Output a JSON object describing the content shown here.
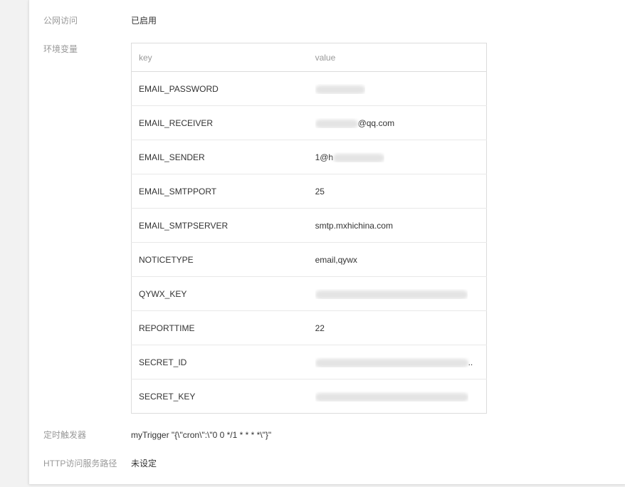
{
  "fields": {
    "public_access": {
      "label": "公网访问",
      "value": "已启用"
    },
    "env_vars": {
      "label": "环境变量"
    },
    "timer_trigger": {
      "label": "定时触发器",
      "value": "myTrigger \"{\\\"cron\\\":\\\"0 0 */1 * * * *\\\"}\""
    },
    "http_path": {
      "label": "HTTP访问服务路径",
      "value": "未设定"
    }
  },
  "env_table": {
    "headers": {
      "key": "key",
      "value": "value"
    },
    "rows": [
      {
        "key": "EMAIL_PASSWORD",
        "value_prefix": "",
        "value_suffix": "",
        "masked": true
      },
      {
        "key": "EMAIL_RECEIVER",
        "value_prefix": "",
        "value_suffix": "@qq.com",
        "masked": true
      },
      {
        "key": "EMAIL_SENDER",
        "value_prefix": "1@h",
        "value_suffix": "",
        "masked": true
      },
      {
        "key": "EMAIL_SMTPPORT",
        "value_prefix": "25",
        "value_suffix": "",
        "masked": false
      },
      {
        "key": "EMAIL_SMTPSERVER",
        "value_prefix": "smtp.mxhichina.com",
        "value_suffix": "",
        "masked": false
      },
      {
        "key": "NOTICETYPE",
        "value_prefix": "email,qywx",
        "value_suffix": "",
        "masked": false
      },
      {
        "key": "QYWX_KEY",
        "value_prefix": "",
        "value_suffix": "",
        "masked": true
      },
      {
        "key": "REPORTTIME",
        "value_prefix": "22",
        "value_suffix": "",
        "masked": false
      },
      {
        "key": "SECRET_ID",
        "value_prefix": "",
        "value_suffix": "..",
        "masked": true
      },
      {
        "key": "SECRET_KEY",
        "value_prefix": "",
        "value_suffix": "",
        "masked": true
      }
    ]
  }
}
